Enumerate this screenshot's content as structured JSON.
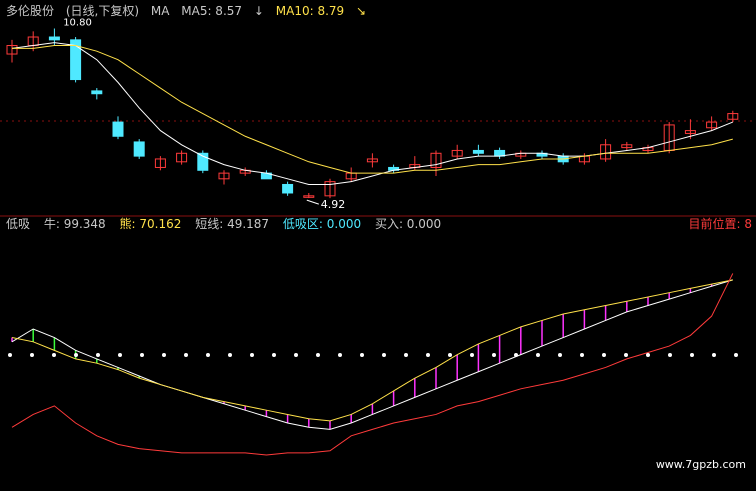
{
  "header": {
    "title": "多伦股份",
    "period": "(日线,下复权)",
    "ma_label": "MA",
    "ma5_label": "MA5: 8.57",
    "ma5_arrow": "↓",
    "ma10_label": "MA10: 8.79",
    "ma10_arrow": "↘",
    "high_note": "10.80"
  },
  "lower_header": {
    "indicator": "低吸",
    "item1": "牛: 99.348",
    "item2": "熊: 70.162",
    "item3": "短线: 49.187",
    "item4": "低吸区: 0.000",
    "item5": "买入: 0.000",
    "position": "目前位置: 8"
  },
  "annotation_low": "4.92",
  "watermark": "www.7gpzb.com",
  "colors": {
    "up": "#ff3b3b",
    "down": "#4fe9ff",
    "ma5": "#ffffff",
    "ma10": "#ffe14a",
    "ma20": "#e23ce2",
    "ma30": "#28d23c",
    "ma60": "#c4c4c4",
    "ma120": "#4fd7e6",
    "grid": "#8a1010",
    "osc_green": "#3cff3c",
    "osc_magenta": "#ff33ff",
    "slow": "#ffe14a"
  },
  "chart_data": [
    {
      "type": "candlestick",
      "title": "多伦股份 (日线,下复权)",
      "x": [
        1,
        2,
        3,
        4,
        5,
        6,
        7,
        8,
        9,
        10,
        11,
        12,
        13,
        14,
        15,
        16,
        17,
        18,
        19,
        20,
        21,
        22,
        23,
        24,
        25,
        26,
        27,
        28,
        29,
        30,
        31,
        32,
        33,
        34,
        35
      ],
      "candles": [
        {
          "o": 10.0,
          "h": 10.5,
          "l": 9.7,
          "c": 10.3
        },
        {
          "o": 10.3,
          "h": 10.8,
          "l": 10.1,
          "c": 10.6
        },
        {
          "o": 10.6,
          "h": 10.9,
          "l": 10.3,
          "c": 10.5
        },
        {
          "o": 10.5,
          "h": 10.6,
          "l": 9.0,
          "c": 9.1
        },
        {
          "o": 8.7,
          "h": 8.8,
          "l": 8.4,
          "c": 8.6
        },
        {
          "o": 7.6,
          "h": 7.8,
          "l": 7.0,
          "c": 7.1
        },
        {
          "o": 6.9,
          "h": 7.0,
          "l": 6.3,
          "c": 6.4
        },
        {
          "o": 6.0,
          "h": 6.4,
          "l": 5.9,
          "c": 6.3
        },
        {
          "o": 6.2,
          "h": 6.6,
          "l": 6.1,
          "c": 6.5
        },
        {
          "o": 6.5,
          "h": 6.6,
          "l": 5.8,
          "c": 5.9
        },
        {
          "o": 5.6,
          "h": 5.9,
          "l": 5.4,
          "c": 5.8
        },
        {
          "o": 5.8,
          "h": 6.0,
          "l": 5.7,
          "c": 5.9
        },
        {
          "o": 5.8,
          "h": 5.9,
          "l": 5.6,
          "c": 5.6
        },
        {
          "o": 5.4,
          "h": 5.5,
          "l": 5.0,
          "c": 5.1
        },
        {
          "o": 4.95,
          "h": 5.1,
          "l": 4.92,
          "c": 5.0
        },
        {
          "o": 5.0,
          "h": 5.6,
          "l": 4.92,
          "c": 5.5
        },
        {
          "o": 5.6,
          "h": 6.0,
          "l": 5.5,
          "c": 5.8
        },
        {
          "o": 6.2,
          "h": 6.5,
          "l": 6.0,
          "c": 6.3
        },
        {
          "o": 6.0,
          "h": 6.1,
          "l": 5.8,
          "c": 5.9
        },
        {
          "o": 6.0,
          "h": 6.4,
          "l": 5.9,
          "c": 6.1
        },
        {
          "o": 6.0,
          "h": 6.6,
          "l": 5.7,
          "c": 6.5
        },
        {
          "o": 6.4,
          "h": 6.8,
          "l": 6.3,
          "c": 6.6
        },
        {
          "o": 6.6,
          "h": 6.8,
          "l": 6.4,
          "c": 6.5
        },
        {
          "o": 6.6,
          "h": 6.7,
          "l": 6.3,
          "c": 6.4
        },
        {
          "o": 6.4,
          "h": 6.6,
          "l": 6.3,
          "c": 6.5
        },
        {
          "o": 6.5,
          "h": 6.6,
          "l": 6.3,
          "c": 6.4
        },
        {
          "o": 6.4,
          "h": 6.5,
          "l": 6.1,
          "c": 6.2
        },
        {
          "o": 6.2,
          "h": 6.5,
          "l": 6.1,
          "c": 6.4
        },
        {
          "o": 6.3,
          "h": 7.0,
          "l": 6.2,
          "c": 6.8
        },
        {
          "o": 6.7,
          "h": 6.9,
          "l": 6.6,
          "c": 6.8
        },
        {
          "o": 6.6,
          "h": 6.8,
          "l": 6.5,
          "c": 6.7
        },
        {
          "o": 6.6,
          "h": 7.6,
          "l": 6.5,
          "c": 7.5
        },
        {
          "o": 7.2,
          "h": 7.7,
          "l": 7.0,
          "c": 7.3
        },
        {
          "o": 7.4,
          "h": 7.8,
          "l": 7.3,
          "c": 7.6
        },
        {
          "o": 7.7,
          "h": 8.0,
          "l": 7.6,
          "c": 7.9
        }
      ],
      "series": [
        {
          "name": "MA5",
          "values": [
            10.2,
            10.3,
            10.4,
            10.3,
            9.8,
            9.0,
            8.1,
            7.3,
            6.8,
            6.4,
            6.1,
            5.9,
            5.8,
            5.6,
            5.4,
            5.4,
            5.5,
            5.7,
            5.9,
            6.0,
            6.1,
            6.3,
            6.4,
            6.4,
            6.5,
            6.5,
            6.4,
            6.4,
            6.5,
            6.6,
            6.7,
            6.9,
            7.1,
            7.3,
            7.6
          ]
        },
        {
          "name": "MA10",
          "values": [
            10.2,
            10.2,
            10.3,
            10.3,
            10.1,
            9.8,
            9.3,
            8.8,
            8.3,
            7.9,
            7.5,
            7.1,
            6.8,
            6.5,
            6.2,
            6.0,
            5.8,
            5.8,
            5.8,
            5.9,
            5.9,
            6.0,
            6.1,
            6.1,
            6.2,
            6.3,
            6.3,
            6.4,
            6.5,
            6.5,
            6.5,
            6.6,
            6.7,
            6.8,
            7.0
          ]
        }
      ],
      "annotations": [
        {
          "text": "4.92",
          "x": 15,
          "y": 4.92
        },
        {
          "text": "10.80",
          "x": 2,
          "y": 10.8
        }
      ],
      "ylim": [
        4.5,
        11.2
      ]
    },
    {
      "type": "line",
      "title": "低吸",
      "x": [
        1,
        2,
        3,
        4,
        5,
        6,
        7,
        8,
        9,
        10,
        11,
        12,
        13,
        14,
        15,
        16,
        17,
        18,
        19,
        20,
        21,
        22,
        23,
        24,
        25,
        26,
        27,
        28,
        29,
        30,
        31,
        32,
        33,
        34,
        35
      ],
      "series": [
        {
          "name": "牛",
          "values": [
            60,
            66,
            62,
            56,
            52,
            48,
            44,
            40,
            37,
            34,
            31,
            28,
            25,
            22,
            20,
            19,
            22,
            26,
            30,
            34,
            38,
            42,
            46,
            50,
            54,
            58,
            62,
            66,
            70,
            74,
            77,
            80,
            83,
            86,
            89
          ]
        },
        {
          "name": "熊",
          "values": [
            62,
            60,
            56,
            52,
            50,
            47,
            43,
            40,
            37,
            34,
            32,
            30,
            28,
            26,
            24,
            23,
            26,
            31,
            37,
            43,
            48,
            54,
            59,
            63,
            67,
            70,
            73,
            75,
            77,
            79,
            81,
            83,
            85,
            87,
            89
          ]
        },
        {
          "name": "短线",
          "values": [
            20,
            26,
            30,
            22,
            16,
            12,
            10,
            9,
            8,
            8,
            8,
            8,
            7,
            8,
            8,
            9,
            16,
            19,
            22,
            24,
            26,
            30,
            32,
            35,
            38,
            40,
            42,
            45,
            48,
            52,
            55,
            58,
            63,
            72,
            92
          ]
        }
      ],
      "ylim": [
        0,
        110
      ]
    }
  ]
}
